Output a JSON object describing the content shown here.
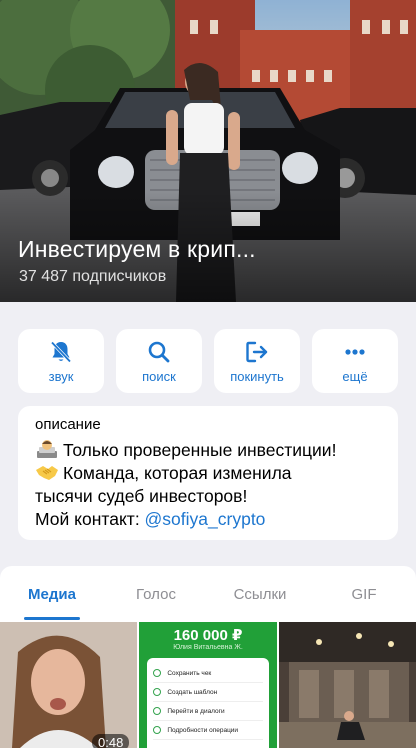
{
  "channel": {
    "title": "Инвестируем в крип...",
    "subscribers": "37 487 подписчиков"
  },
  "actions": [
    {
      "label": "звук",
      "icon": "bell-off-icon"
    },
    {
      "label": "поиск",
      "icon": "search-icon"
    },
    {
      "label": "покинуть",
      "icon": "leave-icon"
    },
    {
      "label": "ещё",
      "icon": "more-icon"
    }
  ],
  "description": {
    "label": "описание",
    "line1": "Только проверенные инвестиции!",
    "line2": "Команда, которая изменила",
    "line3": "тысячи судеб инвесторов!",
    "contact_prefix": "Мой контакт: ",
    "contact_link": "@sofiya_crypto"
  },
  "tabs": [
    {
      "label": "Медиа",
      "active": true
    },
    {
      "label": "Голос",
      "active": false
    },
    {
      "label": "Ссылки",
      "active": false
    },
    {
      "label": "GIF",
      "active": false
    }
  ],
  "media": {
    "video_duration": "0:48",
    "payment_amount": "160 000 ₽",
    "payment_name": "Юлия Витальевна Ж.",
    "payment_items": [
      "Сохранить чек",
      "Создать шаблон",
      "Перейти в диалоги",
      "Подробности операции"
    ]
  },
  "colors": {
    "accent": "#1d76cf",
    "background": "#efeff4",
    "sber_green": "#21a038"
  }
}
